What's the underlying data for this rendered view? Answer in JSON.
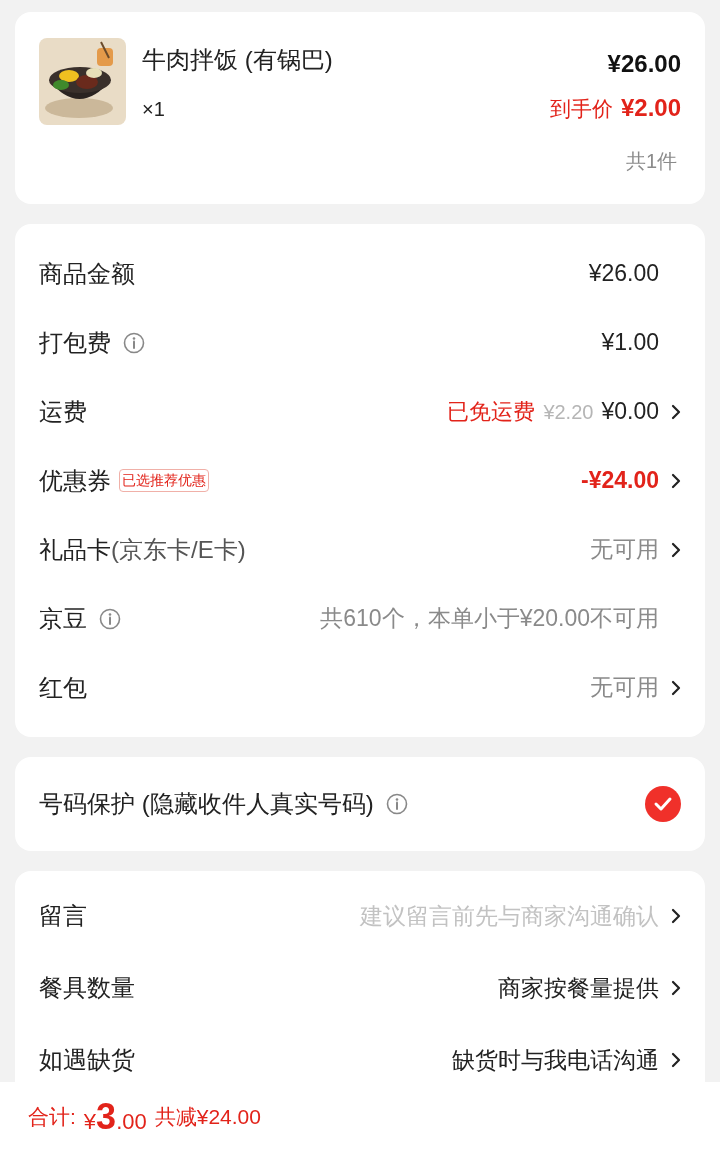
{
  "item": {
    "name": "牛肉拌饭 (有锅巴)",
    "quantity": "×1",
    "price": "¥26.00",
    "final_price_label": "到手价",
    "final_price": "¥2.00",
    "count": "共1件"
  },
  "fees": [
    {
      "label": "商品金额",
      "value": "¥26.00",
      "kind": "normal",
      "chevron": false,
      "info": false
    },
    {
      "label": "打包费",
      "info": true,
      "value": "¥1.00",
      "kind": "normal",
      "chevron": false
    },
    {
      "label": "运费",
      "info": false,
      "note": "已免运费",
      "original_price": "¥2.20",
      "value": "¥0.00",
      "kind": "normal",
      "chevron": true
    },
    {
      "label": "优惠券",
      "info": false,
      "tag": "已选推荐优惠",
      "value": "-¥24.00",
      "kind": "discount",
      "chevron": true
    },
    {
      "label": "礼品卡",
      "label_suffix": "(京东卡/E卡)",
      "info": false,
      "value": "无可用",
      "kind": "muted",
      "chevron": true
    },
    {
      "label": "京豆",
      "info": true,
      "value": "共610个，本单小于¥20.00不可用",
      "kind": "muted",
      "chevron": false
    },
    {
      "label": "红包",
      "info": false,
      "value": "无可用",
      "kind": "muted",
      "chevron": true
    }
  ],
  "privacy": {
    "label": "号码保护 (隐藏收件人真实号码)",
    "checked": true
  },
  "options": [
    {
      "label": "留言",
      "placeholder": "建议留言前先与商家沟通确认"
    },
    {
      "label": "餐具数量",
      "value": "商家按餐量提供"
    },
    {
      "label": "如遇缺货",
      "value": "缺货时与我电话沟通"
    }
  ],
  "footer": {
    "total_label": "合计:",
    "currency": "¥",
    "total_integer": "3",
    "total_decimal": ".00",
    "saving": "共减¥24.00"
  }
}
